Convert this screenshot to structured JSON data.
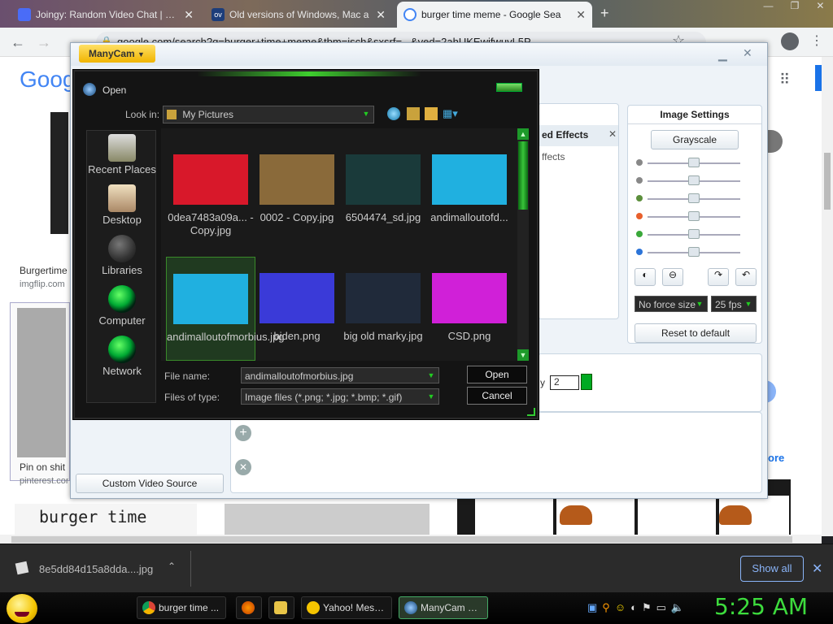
{
  "browser": {
    "tabs": [
      {
        "title": "Joingy: Random Video Chat | We",
        "favicon_color": "#4a6cf7"
      },
      {
        "title": "Old versions of Windows, Mac a",
        "favicon_color": "#1c3d7a"
      },
      {
        "title": "burger time meme - Google Sea",
        "favicon_color": "#ffffff",
        "active": true
      }
    ],
    "new_tab_symbol": "+",
    "address": "google.com/search?q=burger+time+meme&tbm=isch&sxsrf=...&ved=2ahUKEwifwuvL5P",
    "accent": "#1a73e8"
  },
  "google": {
    "logo": "Goog",
    "results": [
      {
        "title": "Burgertime",
        "site": "imgflip.com"
      },
      {
        "title": "Pin on shit",
        "site": "pinterest.com"
      }
    ],
    "thumb_captions": [
      "burger time"
    ],
    "more_label": "ore"
  },
  "manycam": {
    "brand": "ManyCam",
    "effects_tab": "ed Effects",
    "effects_sub": "ffects",
    "image_settings": {
      "title": "Image Settings",
      "grayscale": "Grayscale",
      "sliders": [
        {
          "icon": "brightness-icon",
          "color": "#888888",
          "value": 0.5
        },
        {
          "icon": "contrast-icon",
          "color": "#888888",
          "value": 0.5
        },
        {
          "icon": "hue-icon",
          "color": "#5c8f3c",
          "value": 0.5
        },
        {
          "icon": "red-channel-icon",
          "color": "#e8602c",
          "value": 0.5
        },
        {
          "icon": "green-channel-icon",
          "color": "#3aa83a",
          "value": 0.5
        },
        {
          "icon": "blue-channel-icon",
          "color": "#2c74d8",
          "value": 0.5
        }
      ],
      "force_size": "No force size",
      "fps": "25 fps",
      "reset": "Reset to default"
    },
    "custom_video_source": "Custom Video Source",
    "spin_label": "y",
    "spin_value": "2"
  },
  "dialog": {
    "title": "Open",
    "look_in_label": "Look in:",
    "look_in_value": "My Pictures",
    "places": [
      "Recent Places",
      "Desktop",
      "Libraries",
      "Computer",
      "Network"
    ],
    "files": [
      {
        "name": "0dea7483a09a... - Copy.jpg",
        "thumb": "#d8182a"
      },
      {
        "name": "0002 - Copy.jpg",
        "thumb": "#8a6a3a"
      },
      {
        "name": "6504474_sd.jpg",
        "thumb": "#1a3a3a"
      },
      {
        "name": "andimalloutofd...",
        "thumb": "#20b0e0"
      },
      {
        "name": "andimalloutofmorbius.jpg",
        "thumb": "#20b0e0",
        "selected": true
      },
      {
        "name": "biden.png",
        "thumb": "#3a3ad8"
      },
      {
        "name": "big old marky.jpg",
        "thumb": "#202a3a"
      },
      {
        "name": "CSD.png",
        "thumb": "#d020d8"
      }
    ],
    "file_name_label": "File name:",
    "file_name_value": "andimalloutofmorbius.jpg",
    "files_of_type_label": "Files of type:",
    "files_of_type_value": "Image files (*.png; *.jpg; *.bmp; *.gif)",
    "open_btn": "Open",
    "cancel_btn": "Cancel",
    "glow_color": "#3ecf2e"
  },
  "downloads": {
    "file": "8e5dd84d15a8dda....jpg",
    "show_all": "Show all"
  },
  "taskbar": {
    "items": [
      {
        "label": "burger time ...",
        "icon": "chrome-icon"
      },
      {
        "label": "",
        "icon": "firefox-icon"
      },
      {
        "label": "",
        "icon": "folder-icon"
      },
      {
        "label": "Yahoo! Mess...",
        "icon": "yahoo-icon"
      },
      {
        "label": "ManyCam O...",
        "icon": "manycam-icon",
        "active": true
      }
    ],
    "clock": "5:25 AM"
  }
}
